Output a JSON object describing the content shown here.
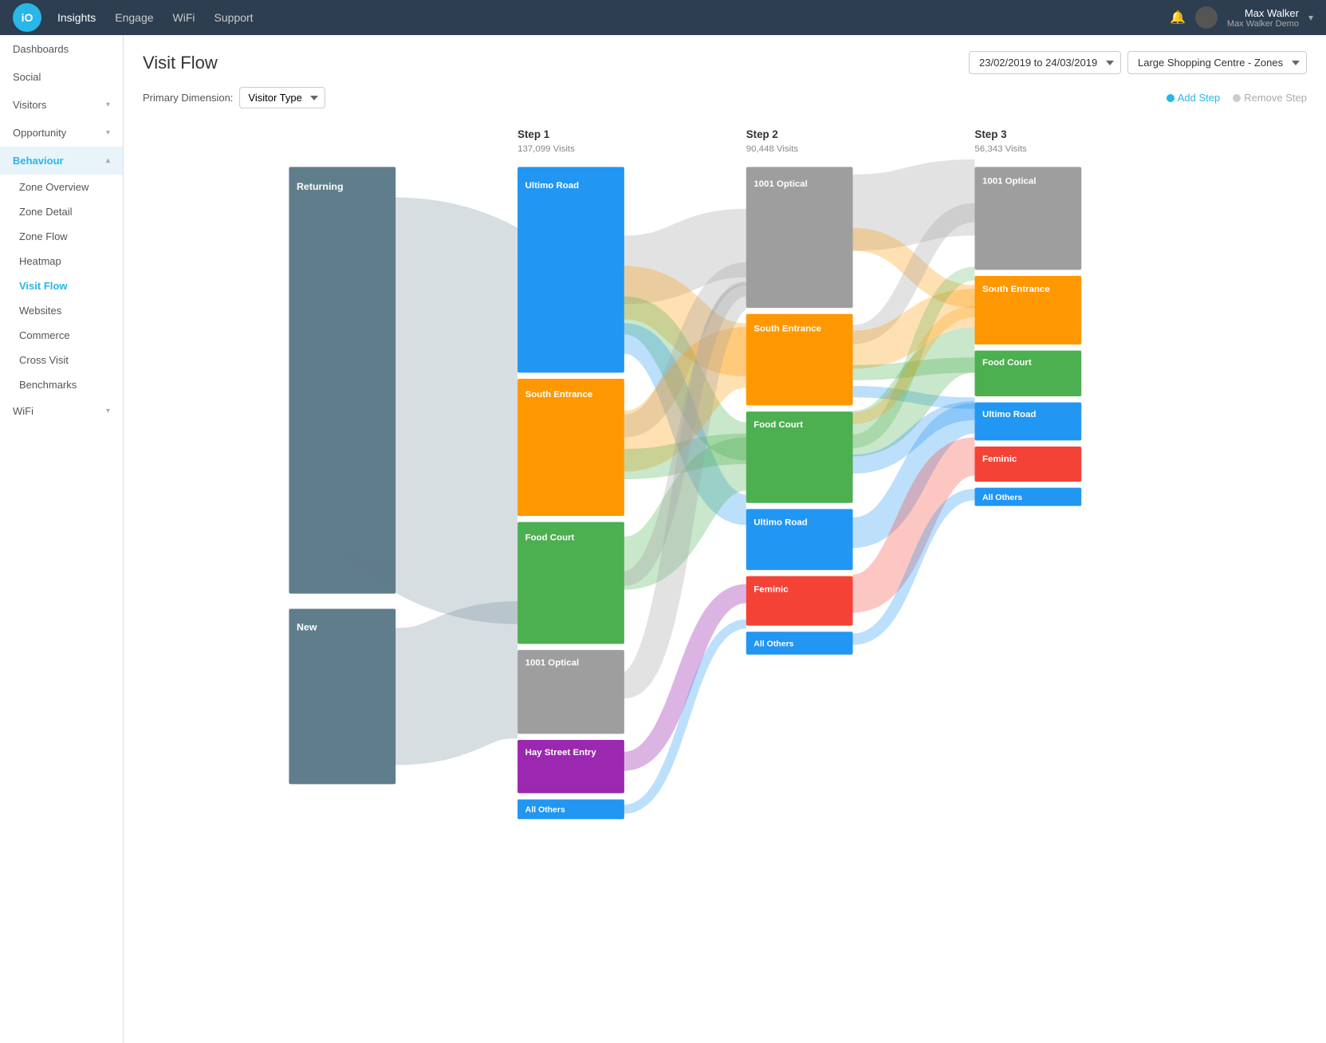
{
  "app": {
    "logo": "iO",
    "nav_items": [
      {
        "label": "Insights",
        "active": true
      },
      {
        "label": "Engage",
        "active": false
      },
      {
        "label": "WiFi",
        "active": false
      },
      {
        "label": "Support",
        "active": false
      }
    ],
    "user": {
      "name": "Max Walker",
      "org": "Max Walker Demo",
      "chevron": "▾"
    }
  },
  "sidebar": {
    "items": [
      {
        "label": "Dashboards",
        "id": "dashboards",
        "expandable": false,
        "active": false
      },
      {
        "label": "Social",
        "id": "social",
        "expandable": false,
        "active": false
      },
      {
        "label": "Visitors",
        "id": "visitors",
        "expandable": true,
        "active": false
      },
      {
        "label": "Opportunity",
        "id": "opportunity",
        "expandable": true,
        "active": false
      },
      {
        "label": "Behaviour",
        "id": "behaviour",
        "expandable": true,
        "active": true,
        "section": true
      },
      {
        "label": "Zone Overview",
        "id": "zone-overview",
        "sub": true,
        "active": false
      },
      {
        "label": "Zone Detail",
        "id": "zone-detail",
        "sub": true,
        "active": false
      },
      {
        "label": "Zone Flow",
        "id": "zone-flow",
        "sub": true,
        "active": false
      },
      {
        "label": "Heatmap",
        "id": "heatmap",
        "sub": true,
        "active": false
      },
      {
        "label": "Visit Flow",
        "id": "visit-flow",
        "sub": true,
        "active": true
      },
      {
        "label": "Websites",
        "id": "websites",
        "sub": true,
        "active": false
      },
      {
        "label": "Commerce",
        "id": "commerce",
        "sub": true,
        "active": false
      },
      {
        "label": "Cross Visit",
        "id": "cross-visit",
        "sub": true,
        "active": false
      },
      {
        "label": "Benchmarks",
        "id": "benchmarks",
        "sub": true,
        "active": false
      },
      {
        "label": "WiFi",
        "id": "wifi",
        "expandable": true,
        "active": false
      }
    ]
  },
  "page": {
    "title": "Visit Flow",
    "date_range": "23/02/2019 to 24/03/2019",
    "location": "Large Shopping Centre - Zones",
    "primary_dim_label": "Primary Dimension:",
    "primary_dim_value": "Visitor Type",
    "add_step_label": "Add Step",
    "remove_step_label": "Remove Step"
  },
  "steps": [
    {
      "label": "Step 1",
      "visits": "137,099 Visits"
    },
    {
      "label": "Step 2",
      "visits": "90,448 Visits"
    },
    {
      "label": "Step 3",
      "visits": "56,343 Visits"
    }
  ],
  "step1_nodes": [
    {
      "label": "Returning",
      "color": "#607d8b",
      "id": "returning"
    },
    {
      "label": "New",
      "color": "#607d8b",
      "id": "new"
    }
  ],
  "step2_nodes": [
    {
      "label": "Ultimo Road",
      "color": "#2196f3",
      "id": "ultimo-road"
    },
    {
      "label": "South Entrance",
      "color": "#ff9800",
      "id": "south-entrance"
    },
    {
      "label": "Food Court",
      "color": "#4caf50",
      "id": "food-court"
    },
    {
      "label": "Ultimo Road",
      "color": "#2196f3",
      "id": "ultimo-road-2"
    },
    {
      "label": "Feminic",
      "color": "#f44336",
      "id": "feminic"
    },
    {
      "label": "1001 Optical",
      "color": "#9e9e9e",
      "id": "1001-optical"
    },
    {
      "label": "Hay Street Entry",
      "color": "#9c27b0",
      "id": "hay-street"
    },
    {
      "label": "All Others",
      "color": "#2196f3",
      "id": "all-others"
    }
  ],
  "step3_nodes": [
    {
      "label": "1001 Optical",
      "color": "#9e9e9e",
      "id": "s3-1001"
    },
    {
      "label": "South Entrance",
      "color": "#ff9800",
      "id": "s3-south"
    },
    {
      "label": "Food Court",
      "color": "#4caf50",
      "id": "s3-food"
    },
    {
      "label": "Ultimo Road",
      "color": "#2196f3",
      "id": "s3-ultimo"
    },
    {
      "label": "Feminic",
      "color": "#f44336",
      "id": "s3-feminic"
    },
    {
      "label": "All Others",
      "color": "#2196f3",
      "id": "s3-all-others"
    }
  ],
  "colors": {
    "blue": "#29b6e8",
    "nav_bg": "#2c3e50",
    "sidebar_bg": "#ffffff",
    "active_nav": "#29b6e8"
  }
}
